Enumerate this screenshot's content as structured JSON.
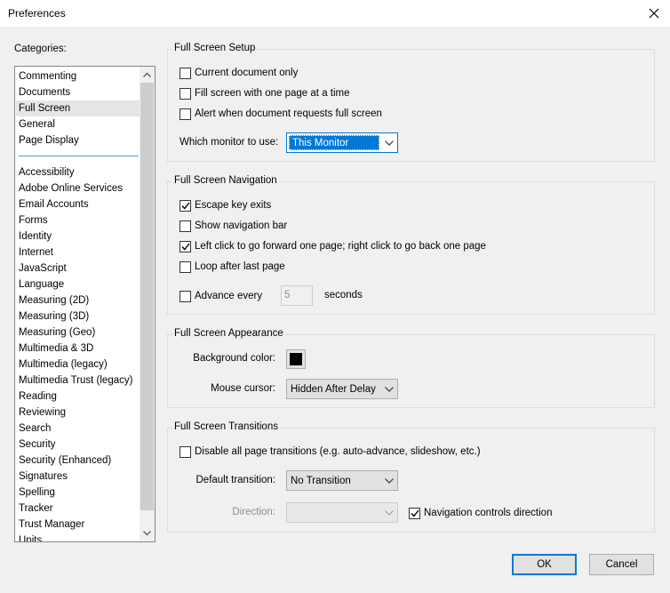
{
  "window": {
    "title": "Preferences"
  },
  "categories": {
    "label": "Categories:",
    "group1": [
      "Commenting",
      "Documents",
      "Full Screen",
      "General",
      "Page Display"
    ],
    "group2": [
      "Accessibility",
      "Adobe Online Services",
      "Email Accounts",
      "Forms",
      "Identity",
      "Internet",
      "JavaScript",
      "Language",
      "Measuring (2D)",
      "Measuring (3D)",
      "Measuring (Geo)",
      "Multimedia & 3D",
      "Multimedia (legacy)",
      "Multimedia Trust (legacy)",
      "Reading",
      "Reviewing",
      "Search",
      "Security",
      "Security (Enhanced)",
      "Signatures",
      "Spelling",
      "Tracker",
      "Trust Manager",
      "Units"
    ],
    "selected": "Full Screen"
  },
  "setup": {
    "title": "Full Screen Setup",
    "current_doc": "Current document only",
    "fill_screen": "Fill screen with one page at a time",
    "alert": "Alert when document requests full screen",
    "monitor_label": "Which monitor to use:",
    "monitor_value": "This Monitor"
  },
  "navigation": {
    "title": "Full Screen Navigation",
    "escape": "Escape key exits",
    "show_nav": "Show navigation bar",
    "left_click": "Left click to go forward one page; right click to go back one page",
    "loop": "Loop after last page",
    "advance": "Advance every",
    "advance_value": "5",
    "seconds": "seconds"
  },
  "appearance": {
    "title": "Full Screen Appearance",
    "bg_label": "Background color:",
    "bg_color": "#000000",
    "cursor_label": "Mouse cursor:",
    "cursor_value": "Hidden After Delay"
  },
  "transitions": {
    "title": "Full Screen Transitions",
    "disable": "Disable all page transitions (e.g. auto-advance, slideshow, etc.)",
    "default_label": "Default transition:",
    "default_value": "No Transition",
    "direction_label": "Direction:",
    "direction_value": "",
    "nav_controls": "Navigation controls direction"
  },
  "buttons": {
    "ok": "OK",
    "cancel": "Cancel"
  }
}
